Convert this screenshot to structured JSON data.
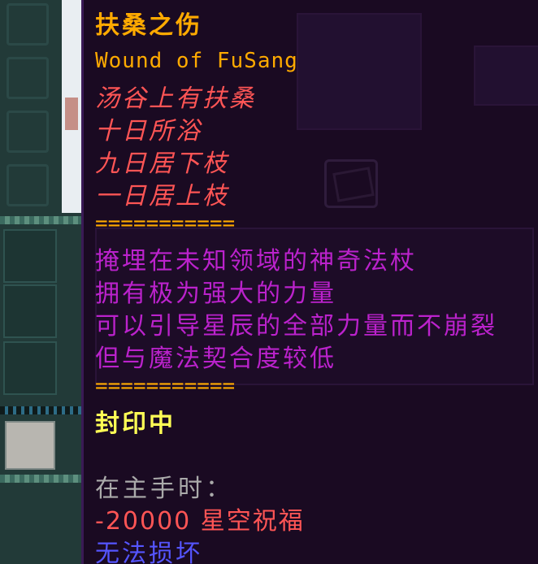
{
  "tooltip": {
    "title": "扶桑之伤",
    "subtitle_en": "Wound of FuSang",
    "poem": [
      "汤谷上有扶桑",
      "十日所浴",
      "九日居下枝",
      "一日居上枝"
    ],
    "separator": "===========",
    "description": [
      "掩埋在未知领域的神奇法杖",
      "拥有极为强大的力量",
      "可以引导星辰的全部力量而不崩裂",
      "但与魔法契合度较低"
    ],
    "status": "封印中",
    "when_in_hand": "在主手时：",
    "attribute_modifier": "-20000 星空祝福",
    "unbreakable": "无法损坏"
  },
  "colors": {
    "title": "#ffaa00",
    "poem": "#ff5555",
    "description": "#bb22cc",
    "status": "#ffff55",
    "when_in_hand": "#aaaaaa",
    "modifier": "#ff5555",
    "unbreakable": "#5555ff",
    "tooltip_bg": "#1a0a22"
  }
}
